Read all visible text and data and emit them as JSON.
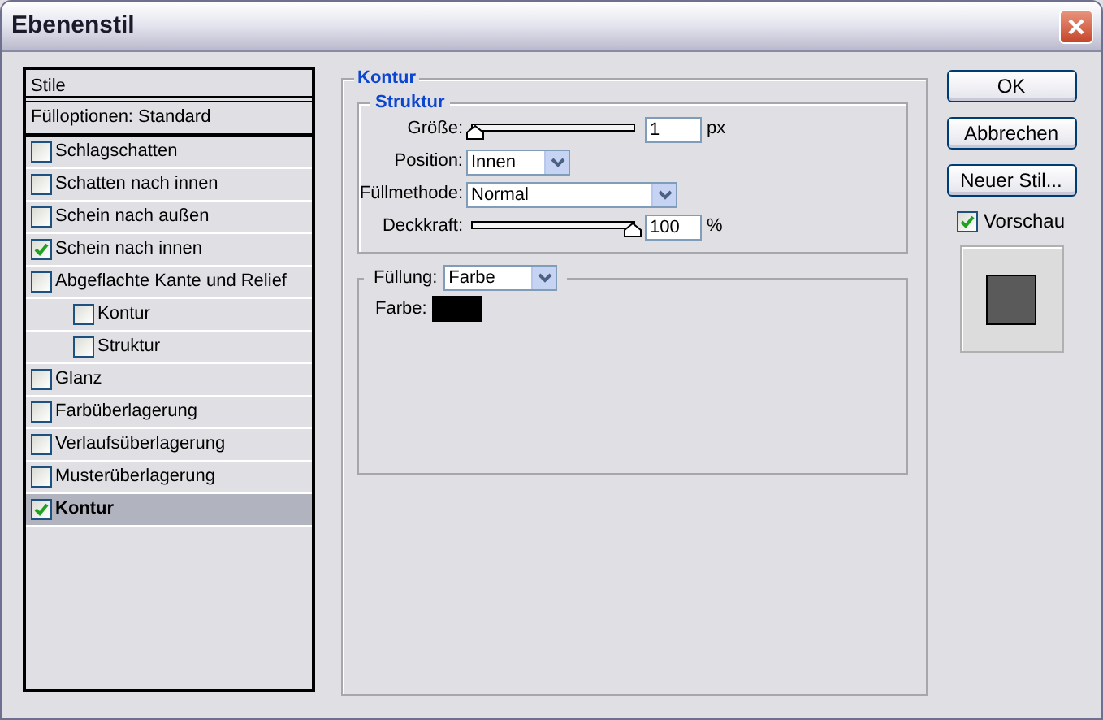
{
  "window": {
    "title": "Ebenenstil"
  },
  "styles": {
    "header": "Stile",
    "items": [
      {
        "label": "Fülloptionen: Standard",
        "kind": "plain",
        "selected": false
      },
      {
        "label": "Schlagschatten",
        "kind": "check",
        "checked": false,
        "selected": false
      },
      {
        "label": "Schatten nach innen",
        "kind": "check",
        "checked": false,
        "selected": false
      },
      {
        "label": "Schein nach außen",
        "kind": "check",
        "checked": false,
        "selected": false
      },
      {
        "label": "Schein nach innen",
        "kind": "check",
        "checked": true,
        "selected": false
      },
      {
        "label": "Abgeflachte Kante und Relief",
        "kind": "check",
        "checked": false,
        "selected": false,
        "children": [
          {
            "label": "Kontur",
            "kind": "check",
            "checked": false,
            "selected": false
          },
          {
            "label": "Struktur",
            "kind": "check",
            "checked": false,
            "selected": false
          }
        ]
      },
      {
        "label": "Glanz",
        "kind": "check",
        "checked": false,
        "selected": false
      },
      {
        "label": "Farbüberlagerung",
        "kind": "check",
        "checked": false,
        "selected": false
      },
      {
        "label": "Verlaufsüberlagerung",
        "kind": "check",
        "checked": false,
        "selected": false
      },
      {
        "label": "Musterüberlagerung",
        "kind": "check",
        "checked": false,
        "selected": false
      },
      {
        "label": "Kontur",
        "kind": "check",
        "checked": true,
        "selected": true
      }
    ]
  },
  "panel": {
    "title": "Kontur",
    "structure": {
      "title": "Struktur",
      "rows": [
        {
          "kind": "slider",
          "label": "Größe:",
          "level": 0,
          "value": "1",
          "unit": "px"
        },
        {
          "kind": "select",
          "label": "Position:",
          "value": "Innen",
          "wide": false
        },
        {
          "kind": "select",
          "label": "Füllmethode:",
          "value": "Normal",
          "wide": true
        },
        {
          "kind": "slider",
          "label": "Deckkraft:",
          "level": 1,
          "value": "100",
          "unit": "%"
        }
      ]
    },
    "fill": {
      "label": "Füllung:",
      "value": "Farbe",
      "color_label": "Farbe:",
      "color": "#000000"
    }
  },
  "buttons": [
    "OK",
    "Abbrechen",
    "Neuer Stil..."
  ],
  "preview": {
    "label": "Vorschau",
    "checked": true
  }
}
